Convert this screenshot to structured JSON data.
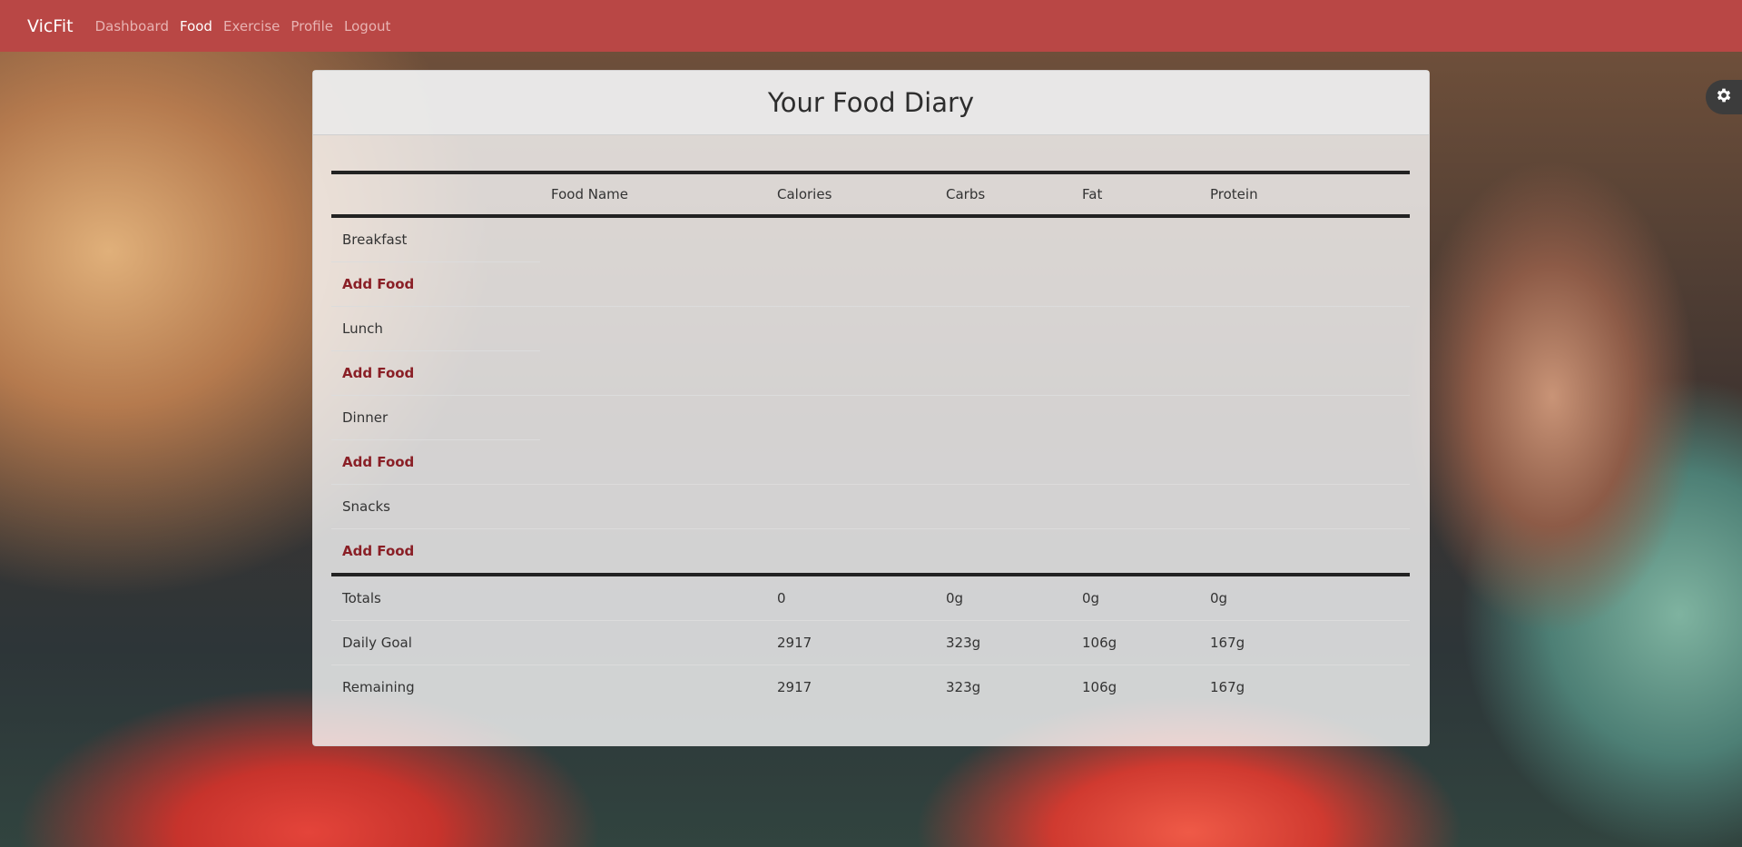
{
  "nav": {
    "brand": "VicFit",
    "links": [
      {
        "label": "Dashboard",
        "active": false
      },
      {
        "label": "Food",
        "active": true
      },
      {
        "label": "Exercise",
        "active": false
      },
      {
        "label": "Profile",
        "active": false
      },
      {
        "label": "Logout",
        "active": false
      }
    ]
  },
  "page": {
    "title": "Your Food Diary"
  },
  "table": {
    "headers": [
      "",
      "Food Name",
      "Calories",
      "Carbs",
      "Fat",
      "Protein"
    ],
    "meals": [
      {
        "name": "Breakfast",
        "add_label": "Add Food"
      },
      {
        "name": "Lunch",
        "add_label": "Add Food"
      },
      {
        "name": "Dinner",
        "add_label": "Add Food"
      },
      {
        "name": "Snacks",
        "add_label": "Add Food"
      }
    ],
    "summary": [
      {
        "label": "Totals",
        "calories": "0",
        "carbs": "0g",
        "fat": "0g",
        "protein": "0g"
      },
      {
        "label": "Daily Goal",
        "calories": "2917",
        "carbs": "323g",
        "fat": "106g",
        "protein": "167g"
      },
      {
        "label": "Remaining",
        "calories": "2917",
        "carbs": "323g",
        "fat": "106g",
        "protein": "167g"
      }
    ]
  },
  "icons": {
    "settings": "gear-icon"
  },
  "colors": {
    "navbar": "#b94745",
    "add_link": "#8a1f26"
  }
}
